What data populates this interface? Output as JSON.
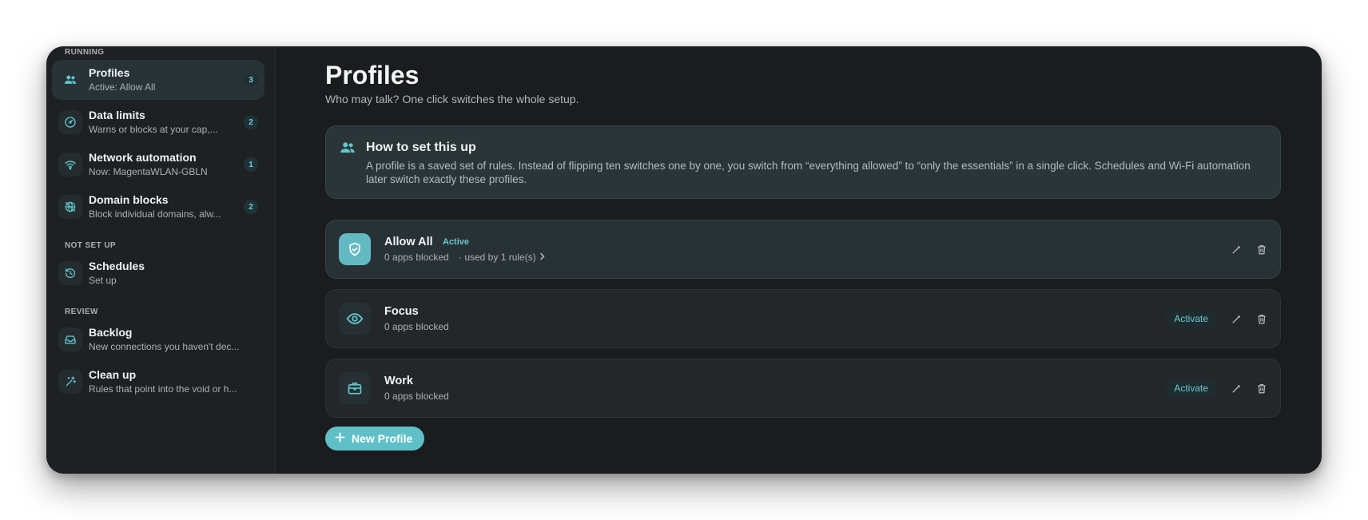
{
  "sidebar": {
    "sections": {
      "running": "RUNNING",
      "not_set_up": "NOT SET UP",
      "review": "REVIEW"
    },
    "items": [
      {
        "title": "Profiles",
        "subtitle": "Active: Allow All",
        "badge": "3",
        "icon": "people-icon"
      },
      {
        "title": "Data limits",
        "subtitle": "Warns or blocks at your cap,...",
        "badge": "2",
        "icon": "gauge-icon"
      },
      {
        "title": "Network automation",
        "subtitle": "Now: MagentaWLAN-GBLN",
        "badge": "1",
        "icon": "wifi-icon"
      },
      {
        "title": "Domain blocks",
        "subtitle": "Block individual domains, alw...",
        "badge": "2",
        "icon": "globe-block-icon"
      },
      {
        "title": "Schedules",
        "subtitle": "Set up",
        "icon": "history-icon"
      },
      {
        "title": "Backlog",
        "subtitle": "New connections you haven't dec...",
        "icon": "inbox-icon"
      },
      {
        "title": "Clean up",
        "subtitle": "Rules that point into the void or h...",
        "icon": "magic-wand-icon"
      }
    ]
  },
  "main": {
    "title": "Profiles",
    "subtitle": "Who may talk? One click switches the whole setup.",
    "info": {
      "title": "How to set this up",
      "body": "A profile is a saved set of rules. Instead of flipping ten switches one by one, you switch from “everything allowed” to “only the essentials” in a single click. Schedules and Wi-Fi automation later switch exactly these profiles."
    },
    "profiles": [
      {
        "name": "Allow All",
        "badge": "Active",
        "meta": "0 apps blocked",
        "usage": "· used by 1 rule(s)",
        "icon": "shield-check-icon"
      },
      {
        "name": "Focus",
        "meta": "0 apps blocked",
        "action": "Activate",
        "icon": "eye-icon"
      },
      {
        "name": "Work",
        "meta": "0 apps blocked",
        "action": "Activate",
        "icon": "briefcase-icon"
      }
    ],
    "new_button": "New Profile"
  },
  "colors": {
    "accent": "#5fc0c8",
    "background": "#1a1c1e",
    "sidebar": "#1e2123"
  }
}
